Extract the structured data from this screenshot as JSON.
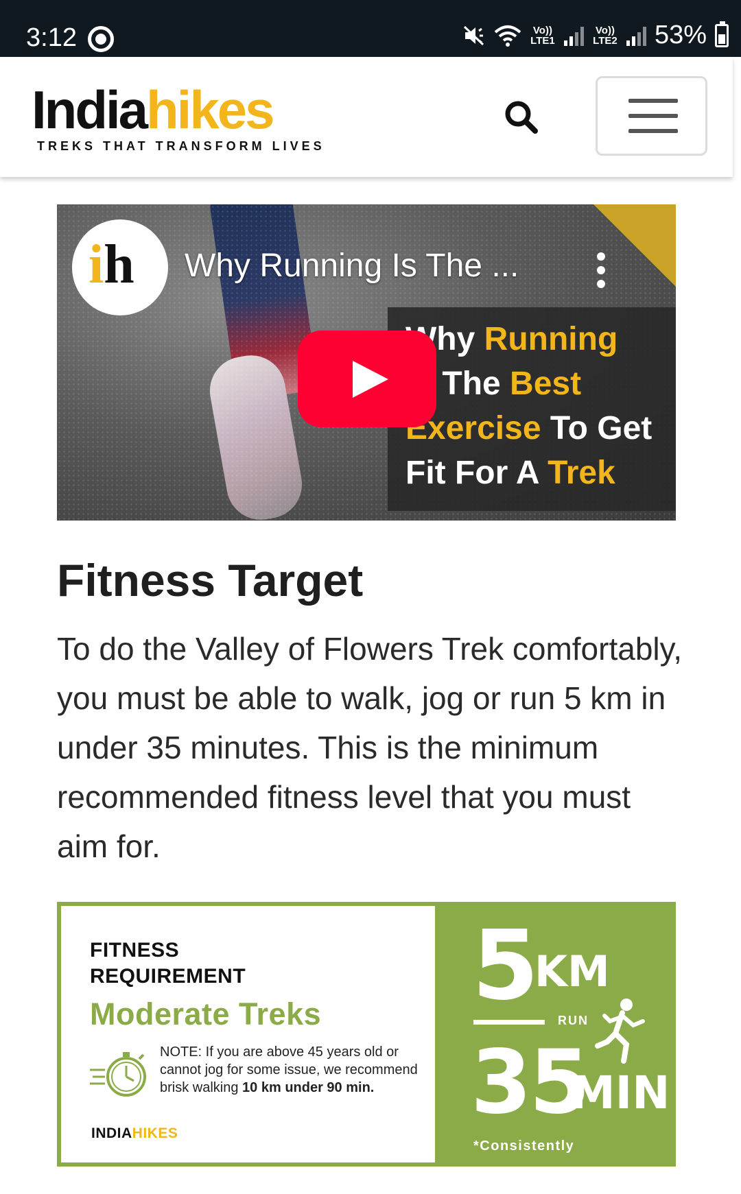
{
  "status_bar": {
    "time": "3:12",
    "battery": "53%",
    "sim1_label": "Vo)) LTE1",
    "sim2_label": "Vo)) LTE2"
  },
  "header": {
    "logo_part1": "India",
    "logo_part2": "hikes",
    "tagline": "TREKS THAT TRANSFORM LIVES",
    "brand_color": "#f2b51c"
  },
  "video": {
    "title": "Why Running Is The ...",
    "thumbnail_lines": [
      [
        {
          "t": "Why ",
          "c": "w"
        },
        {
          "t": "Running",
          "c": "y"
        }
      ],
      [
        {
          "t": "Is ",
          "c": "w"
        },
        {
          "t": "The ",
          "c": "w"
        },
        {
          "t": "Best",
          "c": "y"
        }
      ],
      [
        {
          "t": "Exercise",
          "c": "y"
        },
        {
          "t": " To Get",
          "c": "w"
        }
      ],
      [
        {
          "t": "Fit For A ",
          "c": "w"
        },
        {
          "t": "Trek",
          "c": "y"
        }
      ]
    ],
    "play_color": "#ff0033"
  },
  "content": {
    "heading": "Fitness Target",
    "paragraph": "To do the Valley of Flowers Trek comfortably, you must be able to walk, jog or run 5 km in under 35 minutes. This is the minimum recommended fitness level that you must aim for."
  },
  "fitness_card": {
    "label_line1": "FITNESS",
    "label_line2": "REQUIREMENT",
    "trek_type": "Moderate Treks",
    "note_prefix": "NOTE: If you are above 45 years old or cannot jog for some issue, we recommend brisk walking ",
    "note_bold": "10 km under 90 min.",
    "brand_part1": "INDIA",
    "brand_part2": "HIKES",
    "distance": "5",
    "distance_unit": "KM",
    "activity": "RUN",
    "time": "35",
    "time_unit": "MIN",
    "footnote": "*Consistently",
    "accent_color": "#8aab47"
  }
}
